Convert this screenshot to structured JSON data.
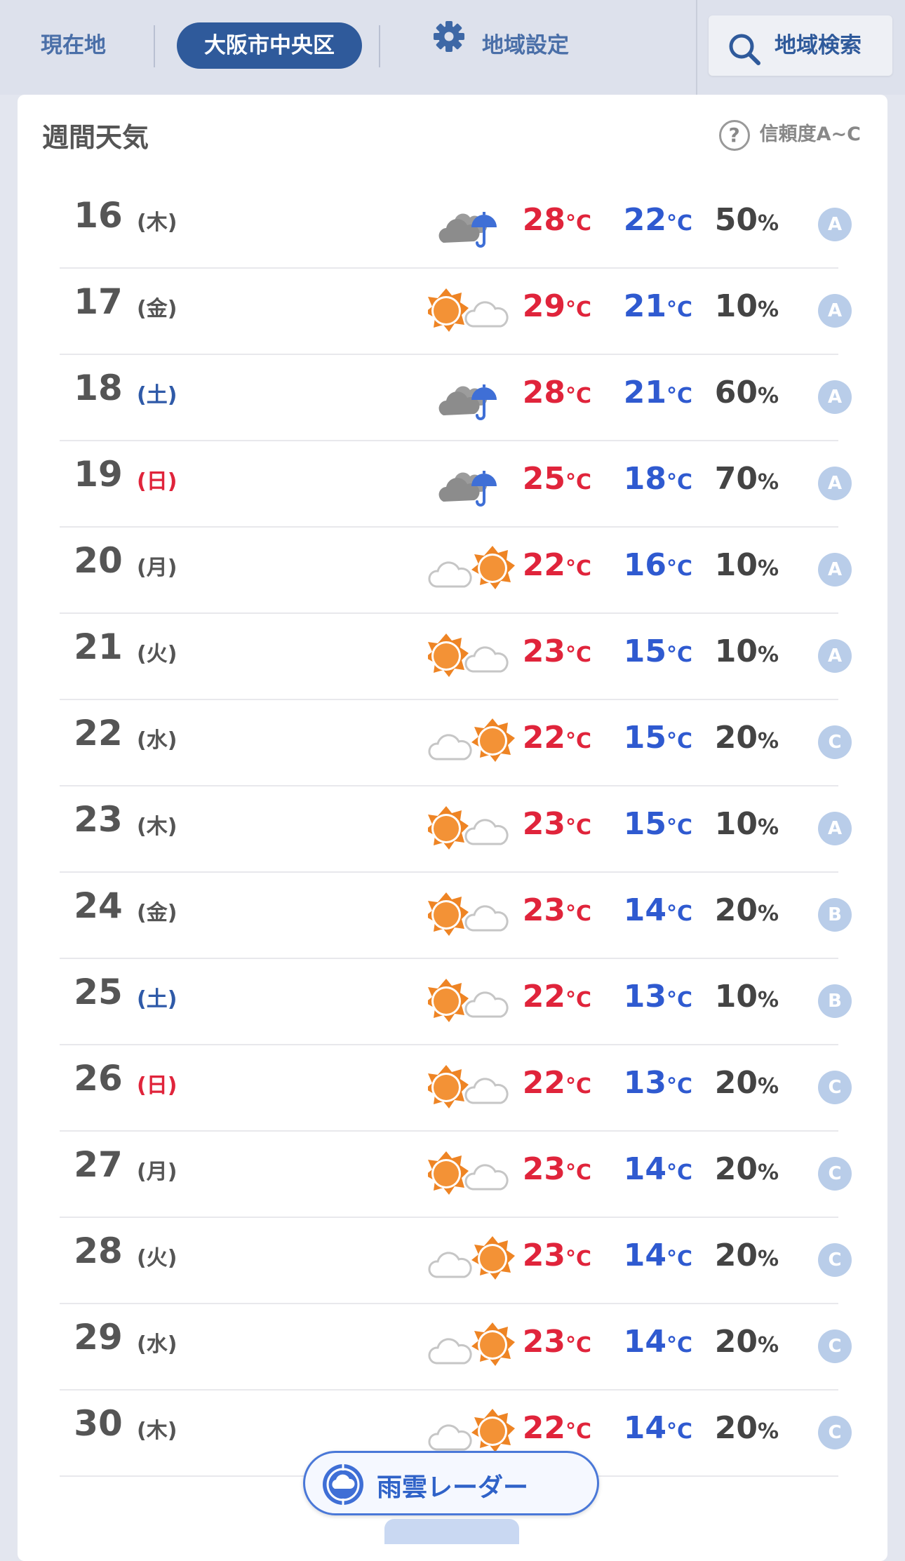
{
  "nav": {
    "current_location": "現在地",
    "selected_area": "大阪市中央区",
    "area_settings": "地域設定",
    "area_search": "地域検索"
  },
  "card": {
    "title": "週間天気",
    "reliability_label": "信頼度A~C"
  },
  "temp_unit": "°C",
  "pop_unit": "%",
  "days": [
    {
      "day": "16",
      "dow": "(木)",
      "dow_type": "weekday",
      "icon": "cloud-rain-icon",
      "high": "28",
      "low": "22",
      "pop": "50",
      "grade": "A"
    },
    {
      "day": "17",
      "dow": "(金)",
      "dow_type": "weekday",
      "icon": "sun-cloud-icon",
      "high": "29",
      "low": "21",
      "pop": "10",
      "grade": "A"
    },
    {
      "day": "18",
      "dow": "(土)",
      "dow_type": "sat",
      "icon": "cloud-rain-icon",
      "high": "28",
      "low": "21",
      "pop": "60",
      "grade": "A"
    },
    {
      "day": "19",
      "dow": "(日)",
      "dow_type": "sun",
      "icon": "cloud-rain-icon",
      "high": "25",
      "low": "18",
      "pop": "70",
      "grade": "A"
    },
    {
      "day": "20",
      "dow": "(月)",
      "dow_type": "weekday",
      "icon": "cloud-sun-icon",
      "high": "22",
      "low": "16",
      "pop": "10",
      "grade": "A"
    },
    {
      "day": "21",
      "dow": "(火)",
      "dow_type": "weekday",
      "icon": "sun-cloud-icon",
      "high": "23",
      "low": "15",
      "pop": "10",
      "grade": "A"
    },
    {
      "day": "22",
      "dow": "(水)",
      "dow_type": "weekday",
      "icon": "cloud-sun-icon",
      "high": "22",
      "low": "15",
      "pop": "20",
      "grade": "C"
    },
    {
      "day": "23",
      "dow": "(木)",
      "dow_type": "weekday",
      "icon": "sun-cloud-icon",
      "high": "23",
      "low": "15",
      "pop": "10",
      "grade": "A"
    },
    {
      "day": "24",
      "dow": "(金)",
      "dow_type": "weekday",
      "icon": "sun-cloud-icon",
      "high": "23",
      "low": "14",
      "pop": "20",
      "grade": "B"
    },
    {
      "day": "25",
      "dow": "(土)",
      "dow_type": "sat",
      "icon": "sun-cloud-icon",
      "high": "22",
      "low": "13",
      "pop": "10",
      "grade": "B"
    },
    {
      "day": "26",
      "dow": "(日)",
      "dow_type": "sun",
      "icon": "sun-cloud-icon",
      "high": "22",
      "low": "13",
      "pop": "20",
      "grade": "C"
    },
    {
      "day": "27",
      "dow": "(月)",
      "dow_type": "weekday",
      "icon": "sun-cloud-icon",
      "high": "23",
      "low": "14",
      "pop": "20",
      "grade": "C"
    },
    {
      "day": "28",
      "dow": "(火)",
      "dow_type": "weekday",
      "icon": "cloud-sun-icon",
      "high": "23",
      "low": "14",
      "pop": "20",
      "grade": "C"
    },
    {
      "day": "29",
      "dow": "(水)",
      "dow_type": "weekday",
      "icon": "cloud-sun-icon",
      "high": "23",
      "low": "14",
      "pop": "20",
      "grade": "C"
    },
    {
      "day": "30",
      "dow": "(木)",
      "dow_type": "weekday",
      "icon": "cloud-sun-icon",
      "high": "22",
      "low": "14",
      "pop": "20",
      "grade": "C"
    }
  ],
  "radar_button": "雨雲レーダー",
  "colors": {
    "high_temp": "#e0243b",
    "low_temp": "#2f5ad0",
    "nav_accent": "#2f5a9b",
    "sun": "#f08a24",
    "grade_badge": "#b9cde9"
  }
}
